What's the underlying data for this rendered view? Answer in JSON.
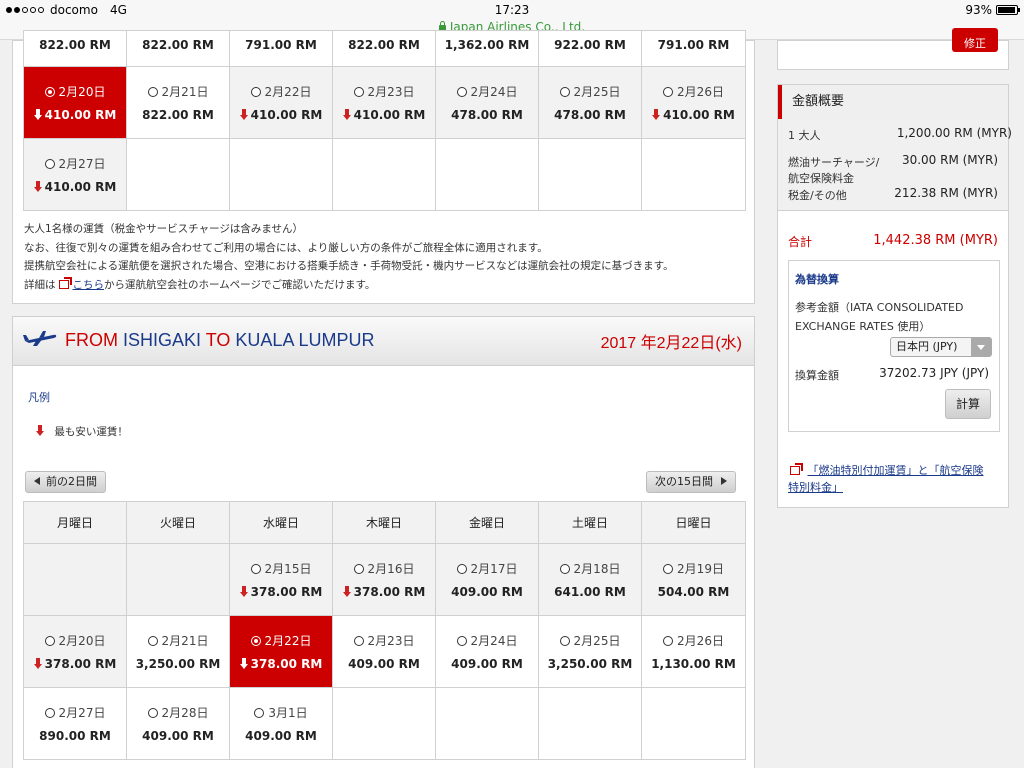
{
  "status_bar": {
    "carrier": "docomo",
    "network": "4G",
    "time": "17:23",
    "battery": "93%",
    "battery_level": 0.93,
    "url": "Japan Airlines Co., Ltd."
  },
  "outbound": {
    "top_prices": [
      "822.00 RM",
      "822.00 RM",
      "791.00 RM",
      "822.00 RM",
      "1,362.00 RM",
      "922.00 RM",
      "791.00 RM"
    ],
    "row2": [
      {
        "date": "2月20日",
        "price": "410.00 RM",
        "lowest": true,
        "selected": true
      },
      {
        "date": "2月21日",
        "price": "822.00 RM",
        "lowest": false
      },
      {
        "date": "2月22日",
        "price": "410.00 RM",
        "lowest": true
      },
      {
        "date": "2月23日",
        "price": "410.00 RM",
        "lowest": true
      },
      {
        "date": "2月24日",
        "price": "478.00 RM",
        "lowest": false
      },
      {
        "date": "2月25日",
        "price": "478.00 RM",
        "lowest": false
      },
      {
        "date": "2月26日",
        "price": "410.00 RM",
        "lowest": true
      }
    ],
    "row3": [
      {
        "date": "2月27日",
        "price": "410.00 RM",
        "lowest": true
      }
    ],
    "notes": {
      "line1": "大人1名様の運賃（税金やサービスチャージは含みません）",
      "line2": "なお、往復で別々の運賃を組み合わせてご利用の場合には、より厳しい方の条件がご旅程全体に適用されます。",
      "line3": "提携航空会社による運航便を選択された場合、空港における搭乗手続き・手荷物受託・機内サービスなどは運航会社の規定に基づきます。",
      "line4_pre": "詳細は",
      "line4_link": "こちら",
      "line4_post": "から運航航空会社のホームページでご確認いただけます。"
    }
  },
  "return_flight": {
    "from_kw": "FROM",
    "origin": "ISHIGAKI",
    "to_kw": "TO",
    "destination": "KUALA LUMPUR",
    "date": "2017 年2月22日(水)",
    "legend_title": "凡例",
    "legend_item": "最も安い運賃！",
    "prev_button": "前の2日間",
    "next_button": "次の15日間",
    "weekdays": [
      "月曜日",
      "火曜日",
      "水曜日",
      "木曜日",
      "金曜日",
      "土曜日",
      "日曜日"
    ],
    "week1": [
      null,
      null,
      {
        "date": "2月15日",
        "price": "378.00 RM",
        "lowest": true
      },
      {
        "date": "2月16日",
        "price": "378.00 RM",
        "lowest": true
      },
      {
        "date": "2月17日",
        "price": "409.00 RM",
        "lowest": false
      },
      {
        "date": "2月18日",
        "price": "641.00 RM",
        "lowest": false
      },
      {
        "date": "2月19日",
        "price": "504.00 RM",
        "lowest": false
      }
    ],
    "week2": [
      {
        "date": "2月20日",
        "price": "378.00 RM",
        "lowest": true
      },
      {
        "date": "2月21日",
        "price": "3,250.00 RM",
        "lowest": false
      },
      {
        "date": "2月22日",
        "price": "378.00 RM",
        "lowest": true,
        "selected": true
      },
      {
        "date": "2月23日",
        "price": "409.00 RM",
        "lowest": false
      },
      {
        "date": "2月24日",
        "price": "409.00 RM",
        "lowest": false
      },
      {
        "date": "2月25日",
        "price": "3,250.00 RM",
        "lowest": false
      },
      {
        "date": "2月26日",
        "price": "1,130.00 RM",
        "lowest": false
      }
    ],
    "week3": [
      {
        "date": "2月27日",
        "price": "890.00 RM",
        "lowest": false
      },
      {
        "date": "2月28日",
        "price": "409.00 RM",
        "lowest": false
      },
      {
        "date": "3月1日",
        "price": "409.00 RM",
        "lowest": false
      },
      null,
      null,
      null,
      null
    ]
  },
  "sidebar": {
    "top_button": "修正",
    "title": "金額概要",
    "adult_label": "1 大人",
    "adult_value": "1,200.00 RM (MYR)",
    "fuel_label_1": "燃油サーチャージ/",
    "fuel_label_2": "航空保険料金",
    "fuel_value": "30.00 RM (MYR)",
    "tax_label": "税金/その他",
    "tax_value": "212.38 RM (MYR)",
    "total_label": "合計",
    "total_value": "1,442.38 RM (MYR)",
    "fx_title": "為替換算",
    "fx_note_1": "参考金額（IATA CONSOLIDATED",
    "fx_note_2": "EXCHANGE RATES 使用）",
    "fx_currency": "日本円 (JPY)",
    "fx_conv_label": "換算金額",
    "fx_conv_value": "37202.73 JPY (JPY)",
    "calc_button": "計算",
    "link_line1": "「燃油特別付加運賃」と「航空保険",
    "link_line2": "特別料金」"
  },
  "colors": {
    "accent": "#cc0000",
    "link": "#1a3a8a",
    "cell_gray": "#f2f2f2",
    "url_green": "#3a9a3a"
  },
  "icons": [
    "lock-icon",
    "radio-icon",
    "down-arrow-icon",
    "plane-icon",
    "external-link-icon",
    "triangle-left-icon",
    "triangle-right-icon",
    "dropdown-arrow-icon"
  ]
}
